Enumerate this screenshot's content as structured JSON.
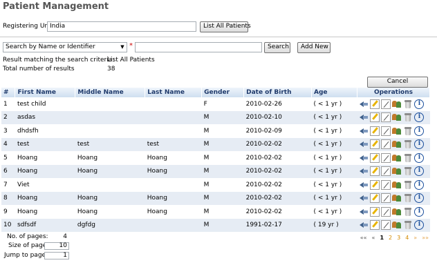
{
  "page": {
    "title": "Patient Management"
  },
  "unit": {
    "label": "Registering Unit",
    "value": "India",
    "list_all_label": "List All Patients"
  },
  "search": {
    "select_value": "Search by Name or Identifier",
    "required_marker": "*",
    "input_value": "",
    "search_label": "Search",
    "add_new_label": "Add New"
  },
  "results": {
    "criteria_label": "Result matching the search criteria:",
    "criteria_value": "List All Patients",
    "total_label": "Total number of results",
    "total_value": "38",
    "cancel_label": "Cancel"
  },
  "table": {
    "headers": [
      "#",
      "First Name",
      "Middle Name",
      "Last Name",
      "Gender",
      "Date of Birth",
      "Age",
      "Operations"
    ],
    "rows": [
      [
        "1",
        "test child",
        "",
        "",
        "F",
        "2010-02-26",
        "( < 1 yr )"
      ],
      [
        "2",
        "asdas",
        "",
        "",
        "M",
        "2010-02-10",
        "( < 1 yr )"
      ],
      [
        "3",
        "dhdsfh",
        "",
        "",
        "M",
        "2010-02-09",
        "( < 1 yr )"
      ],
      [
        "4",
        "test",
        "test",
        "test",
        "M",
        "2010-02-02",
        "( < 1 yr )"
      ],
      [
        "5",
        "Hoang",
        "Hoang",
        "Hoang",
        "M",
        "2010-02-02",
        "( < 1 yr )"
      ],
      [
        "6",
        "Hoang",
        "Hoang",
        "Hoang",
        "M",
        "2010-02-02",
        "( < 1 yr )"
      ],
      [
        "7",
        "Viet",
        "",
        "",
        "M",
        "2010-02-02",
        "( < 1 yr )"
      ],
      [
        "8",
        "Hoang",
        "Hoang",
        "Hoang",
        "M",
        "2010-02-02",
        "( < 1 yr )"
      ],
      [
        "9",
        "Hoang",
        "Hoang",
        "Hoang",
        "M",
        "2010-02-02",
        "( < 1 yr )"
      ],
      [
        "10",
        "sdfsdf",
        "dgfdg",
        "",
        "M",
        "1991-02-17",
        "( 19 yr )"
      ]
    ],
    "operation_icons": [
      "back-arrow-icon",
      "edit-icon",
      "pen-icon",
      "users-icon",
      "trash-bin-icon",
      "info-icon"
    ],
    "info_glyph": "i"
  },
  "pager": {
    "num_pages_label": "No. of pages:",
    "num_pages_value": "4",
    "page_size_label": "Size of page:",
    "page_size_value": "10",
    "jump_label": "Jump to page:",
    "jump_value": "1",
    "first": "««",
    "prev": "«",
    "pages": [
      "1",
      "2",
      "3",
      "4"
    ],
    "next": "»",
    "last": "»»"
  }
}
